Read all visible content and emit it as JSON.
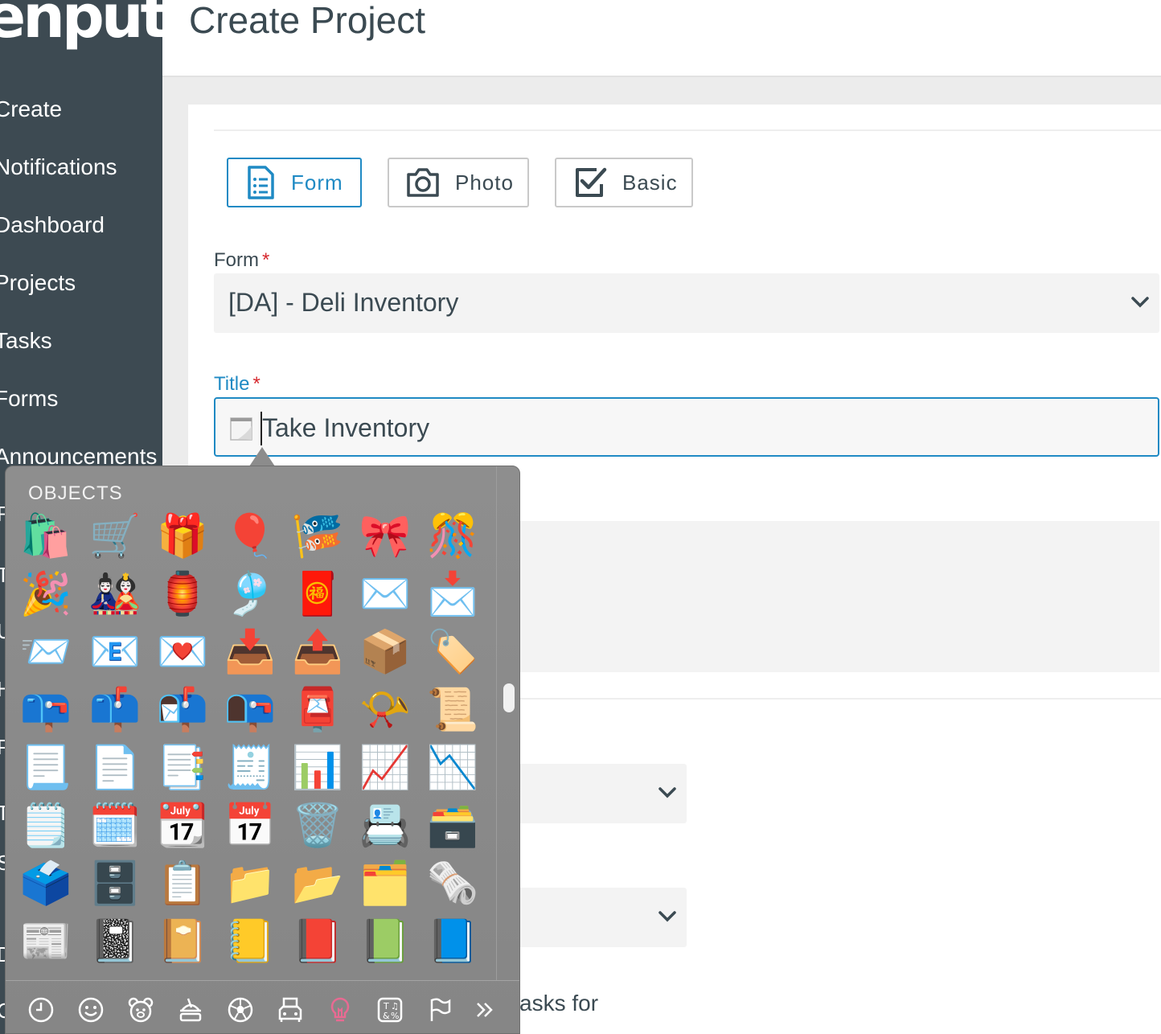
{
  "app": {
    "logo_text": "enput."
  },
  "sidebar": {
    "items": [
      {
        "label": "Create"
      },
      {
        "label": "Notifications"
      },
      {
        "label": "Dashboard"
      },
      {
        "label": "Projects"
      },
      {
        "label": "Tasks"
      },
      {
        "label": "Forms"
      },
      {
        "label": "Announcements"
      }
    ],
    "hidden_stubs": [
      "R",
      "T",
      "U",
      "H",
      "P",
      "T",
      "S",
      "D",
      "C"
    ]
  },
  "header": {
    "title": "Create Project"
  },
  "project_types": [
    {
      "label": "Form",
      "icon": "list-document-icon",
      "active": true
    },
    {
      "label": "Photo",
      "icon": "camera-icon",
      "active": false
    },
    {
      "label": "Basic",
      "icon": "checkbox-icon",
      "active": false
    }
  ],
  "form_field": {
    "label": "Form",
    "required_mark": "*",
    "value": "[DA] - Deli Inventory"
  },
  "title_field": {
    "label": "Title",
    "required_mark": "*",
    "value": "Take Inventory",
    "emoji": "📝"
  },
  "partial": {
    "tasks_text": "asks for"
  },
  "emoji_picker": {
    "category_title": "OBJECTS",
    "emojis": [
      "🛍️",
      "🛒",
      "🎁",
      "🎈",
      "🎏",
      "🎀",
      "🎊",
      "🎉",
      "🎎",
      "🏮",
      "🎐",
      "🧧",
      "✉️",
      "📩",
      "📨",
      "📧",
      "💌",
      "📥",
      "📤",
      "📦",
      "🏷️",
      "📪",
      "📫",
      "📬",
      "📭",
      "📮",
      "📯",
      "📜",
      "📃",
      "📄",
      "📑",
      "🧾",
      "📊",
      "📈",
      "📉",
      "🗒️",
      "🗓️",
      "📆",
      "📅",
      "🗑️",
      "📇",
      "🗃️",
      "🗳️",
      "🗄️",
      "📋",
      "📁",
      "📂",
      "🗂️",
      "🗞️",
      "📰",
      "📓",
      "📔",
      "📒",
      "📕",
      "📗",
      "📘"
    ],
    "categories": [
      {
        "icon": "clock-icon"
      },
      {
        "icon": "smiley-icon"
      },
      {
        "icon": "bear-icon"
      },
      {
        "icon": "food-icon"
      },
      {
        "icon": "soccer-ball-icon"
      },
      {
        "icon": "vehicle-icon"
      },
      {
        "icon": "lightbulb-icon",
        "active": true
      },
      {
        "icon": "symbols-icon"
      },
      {
        "icon": "flag-icon"
      },
      {
        "icon": "more-icon"
      }
    ],
    "accent_active": "#e86a92"
  },
  "colors": {
    "accent": "#1f8ac4",
    "sidebar": "#3d4a52",
    "required": "#d6282e"
  }
}
